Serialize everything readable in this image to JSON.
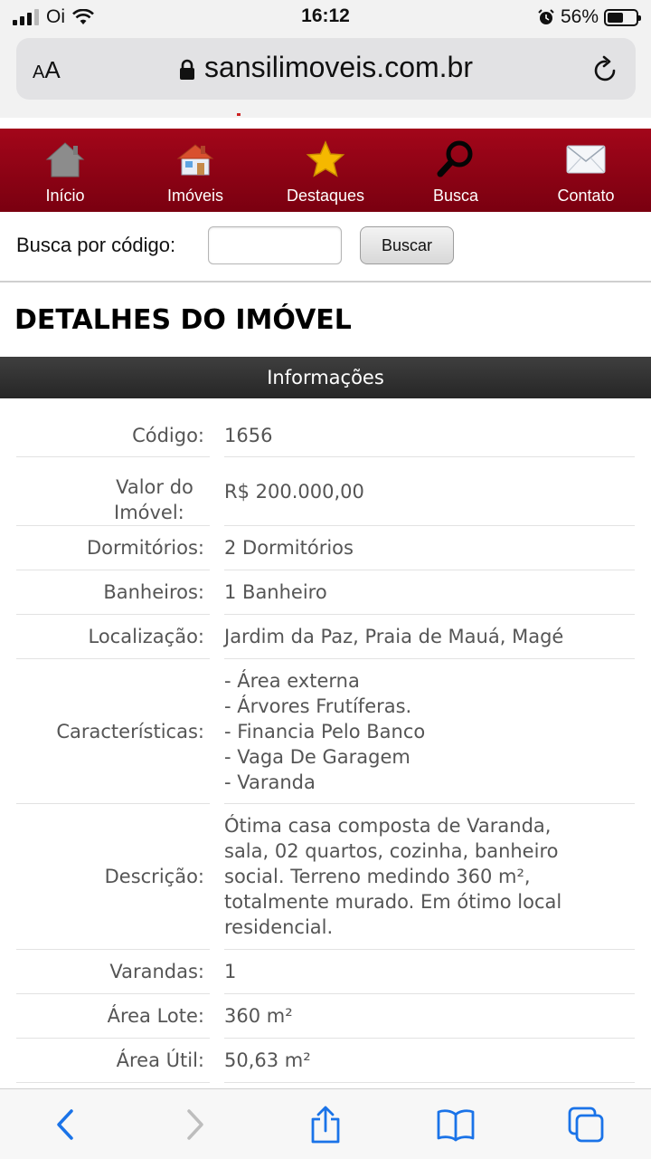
{
  "status_bar": {
    "carrier": "Oi",
    "time": "16:12",
    "battery_percent": "56%",
    "signal_bars_active": 3
  },
  "browser": {
    "text_size_small": "A",
    "text_size_large": "A",
    "url": "sansilimoveis.com.br"
  },
  "nav": {
    "items": [
      {
        "label": "Início",
        "icon": "home-icon"
      },
      {
        "label": "Imóveis",
        "icon": "house-icon"
      },
      {
        "label": "Destaques",
        "icon": "star-icon"
      },
      {
        "label": "Busca",
        "icon": "magnifier-icon"
      },
      {
        "label": "Contato",
        "icon": "envelope-icon"
      }
    ],
    "bg_color": "#8f0416"
  },
  "search": {
    "label": "Busca por código:",
    "value": "",
    "button_label": "Buscar"
  },
  "page_title": "DETALHES DO IMÓVEL",
  "section_title": "Informações",
  "details": {
    "codigo": {
      "label": "Código:",
      "value": "1656"
    },
    "valor": {
      "label_line1": "Valor do",
      "label_line2": "Imóvel:",
      "value": "R$ 200.000,00"
    },
    "dormitorios": {
      "label": "Dormitórios:",
      "value": "2 Dormitórios"
    },
    "banheiros": {
      "label": "Banheiros:",
      "value": "1 Banheiro"
    },
    "localizacao": {
      "label": "Localização:",
      "value": "Jardim da Paz, Praia de Mauá, Magé"
    },
    "caracteristicas": {
      "label": "Características:",
      "items": [
        "- Área externa",
        "- Árvores Frutíferas.",
        "- Financia Pelo Banco",
        "- Vaga De Garagem",
        "- Varanda"
      ]
    },
    "descricao": {
      "label": "Descrição:",
      "lines": [
        "Ótima casa composta de Varanda,",
        "sala, 02 quartos, cozinha, banheiro",
        "social. Terreno medindo 360 m²,",
        "totalmente murado. Em ótimo local",
        "residencial."
      ]
    },
    "varandas": {
      "label": "Varandas:",
      "value": "1"
    },
    "area_lote": {
      "label": "Área Lote:",
      "value": "360 m²"
    },
    "area_util": {
      "label": "Área Útil:",
      "value": "50,63 m²"
    }
  },
  "toolbar": {
    "icons": [
      "back-icon",
      "forward-icon",
      "share-icon",
      "bookmarks-icon",
      "tabs-icon"
    ],
    "accent": "#1a73e8"
  }
}
